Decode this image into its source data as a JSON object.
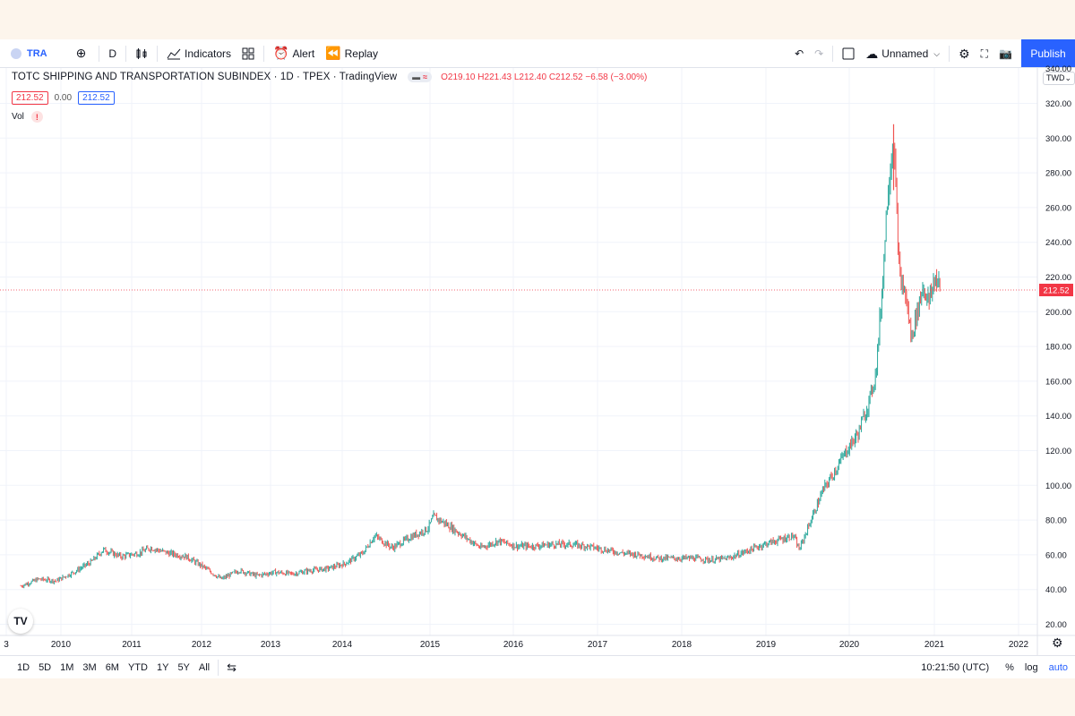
{
  "toolbar": {
    "symbol": "TRA",
    "interval": "D",
    "indicators_label": "Indicators",
    "alert_label": "Alert",
    "replay_label": "Replay",
    "layout_name": "Unnamed",
    "publish_label": "Publish"
  },
  "legend": {
    "title": "TOTC SHIPPING AND TRANSPORTATION SUBINDEX · 1D · TPEX · TradingView",
    "open": "O219.10",
    "high": "H221.43",
    "low": "L212.40",
    "close": "C212.52",
    "change": "−6.58 (−3.00%)",
    "bid": "212.52",
    "spread": "0.00",
    "ask": "212.52",
    "volume_label": "Vol",
    "warning_mark": "!"
  },
  "axis": {
    "currency": "TWD",
    "last_price_label": "212.52"
  },
  "ranges": [
    "1D",
    "5D",
    "1M",
    "3M",
    "6M",
    "YTD",
    "1Y",
    "5Y",
    "All"
  ],
  "status": {
    "clock": "10:21:50 (UTC)",
    "percent": "%",
    "log": "log",
    "auto": "auto"
  },
  "colors": {
    "up": "#26a69a",
    "down": "#ef5350",
    "accent": "#2962ff",
    "last_price": "#f23645"
  },
  "chart_data": {
    "type": "line",
    "title": "TOTC SHIPPING AND TRANSPORTATION SUBINDEX",
    "x_tick_labels": [
      "3",
      "2010",
      "2011",
      "2012",
      "2013",
      "2014",
      "2015",
      "2016",
      "2017",
      "2018",
      "2019",
      "2020",
      "2021",
      "2022"
    ],
    "y_tick_labels": [
      "20.00",
      "40.00",
      "60.00",
      "80.00",
      "100.00",
      "120.00",
      "140.00",
      "160.00",
      "180.00",
      "200.00",
      "220.00",
      "240.00",
      "260.00",
      "280.00",
      "300.00",
      "320.00",
      "340.00"
    ],
    "ylim": [
      20,
      340
    ],
    "grid": true,
    "last_price": 212.52,
    "series": [
      {
        "points": [
          [
            "2009-03",
            42
          ],
          [
            "2009-06",
            46
          ],
          [
            "2009-09",
            45
          ],
          [
            "2009-12",
            50
          ],
          [
            "2010-03",
            56
          ],
          [
            "2010-05",
            63
          ],
          [
            "2010-08",
            59
          ],
          [
            "2010-11",
            61
          ],
          [
            "2011-01",
            64
          ],
          [
            "2011-04",
            61
          ],
          [
            "2011-07",
            59
          ],
          [
            "2011-10",
            53
          ],
          [
            "2012-01",
            46
          ],
          [
            "2012-04",
            51
          ],
          [
            "2012-07",
            48
          ],
          [
            "2012-10",
            50
          ],
          [
            "2013-01",
            49
          ],
          [
            "2013-04",
            51
          ],
          [
            "2013-07",
            52
          ],
          [
            "2013-10",
            55
          ],
          [
            "2014-01",
            61
          ],
          [
            "2014-03",
            71
          ],
          [
            "2014-06",
            64
          ],
          [
            "2014-09",
            70
          ],
          [
            "2014-12",
            75
          ],
          [
            "2015-01",
            82
          ],
          [
            "2015-03",
            78
          ],
          [
            "2015-06",
            71
          ],
          [
            "2015-09",
            64
          ],
          [
            "2015-12",
            68
          ],
          [
            "2016-03",
            65
          ],
          [
            "2016-06",
            65
          ],
          [
            "2016-09",
            66
          ],
          [
            "2016-12",
            66
          ],
          [
            "2017-03",
            65
          ],
          [
            "2017-06",
            63
          ],
          [
            "2017-09",
            61
          ],
          [
            "2017-12",
            60
          ],
          [
            "2018-03",
            58
          ],
          [
            "2018-06",
            58
          ],
          [
            "2018-09",
            58
          ],
          [
            "2018-12",
            57
          ],
          [
            "2019-03",
            58
          ],
          [
            "2019-06",
            62
          ],
          [
            "2019-09",
            66
          ],
          [
            "2019-12",
            69
          ],
          [
            "2020-02",
            71
          ],
          [
            "2020-03",
            63
          ],
          [
            "2020-05",
            80
          ],
          [
            "2020-07",
            97
          ],
          [
            "2020-09",
            108
          ],
          [
            "2020-11",
            120
          ],
          [
            "2021-01",
            130
          ],
          [
            "2021-03",
            150
          ],
          [
            "2021-04",
            165
          ],
          [
            "2021-05",
            210
          ],
          [
            "2021-06",
            270
          ],
          [
            "2021-07",
            300
          ],
          [
            "2021-08",
            220
          ],
          [
            "2021-09",
            210
          ],
          [
            "2021-10",
            185
          ],
          [
            "2021-11",
            200
          ],
          [
            "2021-12",
            215
          ],
          [
            "2022-01",
            205
          ],
          [
            "2022-02",
            220
          ],
          [
            "2022-03",
            212.52
          ]
        ]
      }
    ]
  }
}
